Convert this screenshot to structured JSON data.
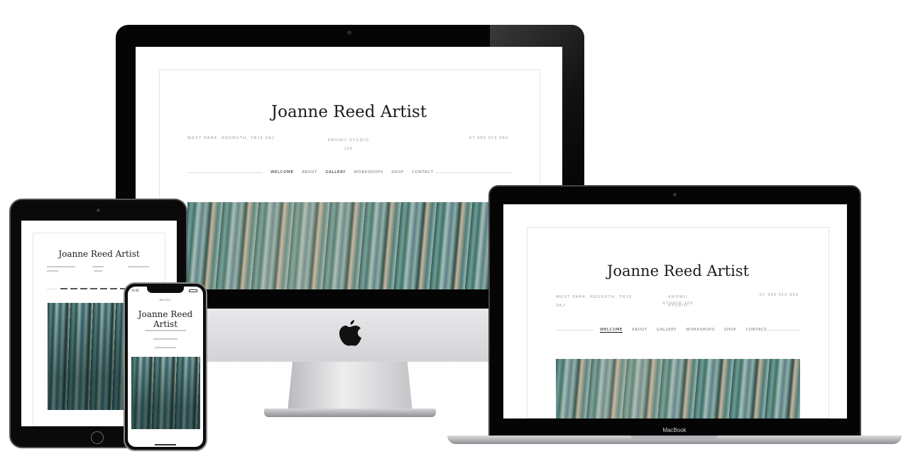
{
  "site": {
    "title": "Joanne Reed Artist",
    "address": "WEST PARK, REDRUTH, TR15 3AJ",
    "address_line1": "WEST PARK, REDRUTH, TR15",
    "address_line2": "3AJ",
    "studio_line1": "KROW// STUDIO",
    "studio_line2": "109",
    "studio": "KROW// STUDIO 109",
    "phone": "07 990 019 960"
  },
  "nav": {
    "items": [
      "WELCOME",
      "ABOUT",
      "GALLERY",
      "WORKSHOPS",
      "SHOP",
      "CONTACT"
    ],
    "active": "WELCOME"
  },
  "devices": {
    "macbook_label": "MacBook",
    "iphone_time": "9:41",
    "iphone_menu": "MENU"
  },
  "colors": {
    "bezel": "#050505",
    "chin": "#d9dadd",
    "text": "#1c1c1c",
    "muted": "#9a9a9a"
  }
}
